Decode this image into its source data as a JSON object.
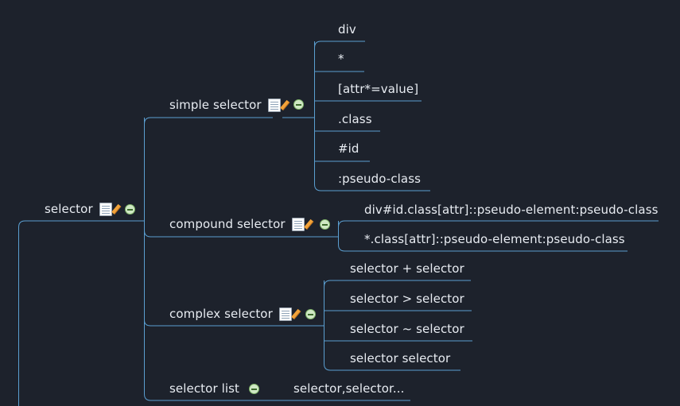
{
  "colors": {
    "background": "#1d222c",
    "line": "#5b9fd1",
    "text": "#e8ecf2",
    "collapse": "#cfe8c4"
  },
  "mindmap": {
    "root": {
      "label": "selector",
      "icon": "note-icon"
    },
    "branches": [
      {
        "label": "simple selector",
        "icon": "note-icon",
        "children": [
          "div",
          "*",
          "[attr*=value]",
          ".class",
          "#id",
          ":pseudo-class"
        ]
      },
      {
        "label": "compound selector",
        "icon": "note-icon",
        "children": [
          "div#id.class[attr]::pseudo-element:pseudo-class",
          "*.class[attr]::pseudo-element:pseudo-class"
        ]
      },
      {
        "label": "complex selector",
        "icon": "note-icon",
        "children": [
          "selector + selector",
          "selector > selector",
          "selector ~ selector",
          "selector selector"
        ]
      },
      {
        "label": "selector list",
        "children": [
          "selector,selector..."
        ]
      }
    ]
  }
}
